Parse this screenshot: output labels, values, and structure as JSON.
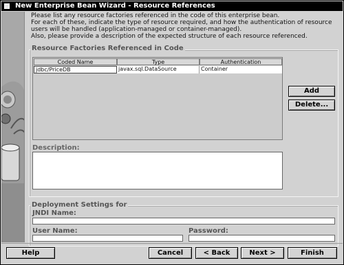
{
  "window": {
    "title": "New Enterprise Bean Wizard - Resource References"
  },
  "intro": {
    "line1": "Please list any resource factories referenced in the code of this enterprise bean.",
    "line2": "For each of these, indicate the type of resource required, and how the authentication of resource",
    "line3": "users will be handled (application-managed or container-managed).",
    "line4": "Also, please provide a description of the expected structure of each resource referenced."
  },
  "factories": {
    "group_label": "Resource Factories Referenced in Code",
    "columns": [
      "Coded Name",
      "Type",
      "Authentication"
    ],
    "rows": [
      {
        "coded_name": "jdbc/PriceDB",
        "type": "javax.sql.DataSource",
        "authentication": "Container"
      }
    ],
    "add_label": "Add",
    "delete_label": "Delete..."
  },
  "description": {
    "label": "Description:",
    "value": ""
  },
  "deployment": {
    "group_label": "Deployment Settings for",
    "jndi_label": "JNDI Name:",
    "jndi_value": "",
    "username_label": "User Name:",
    "username_value": "",
    "password_label": "Password:",
    "password_value": ""
  },
  "footer": {
    "help_label": "Help",
    "cancel_label": "Cancel",
    "back_label": "< Back",
    "next_label": "Next >",
    "finish_label": "Finish"
  }
}
